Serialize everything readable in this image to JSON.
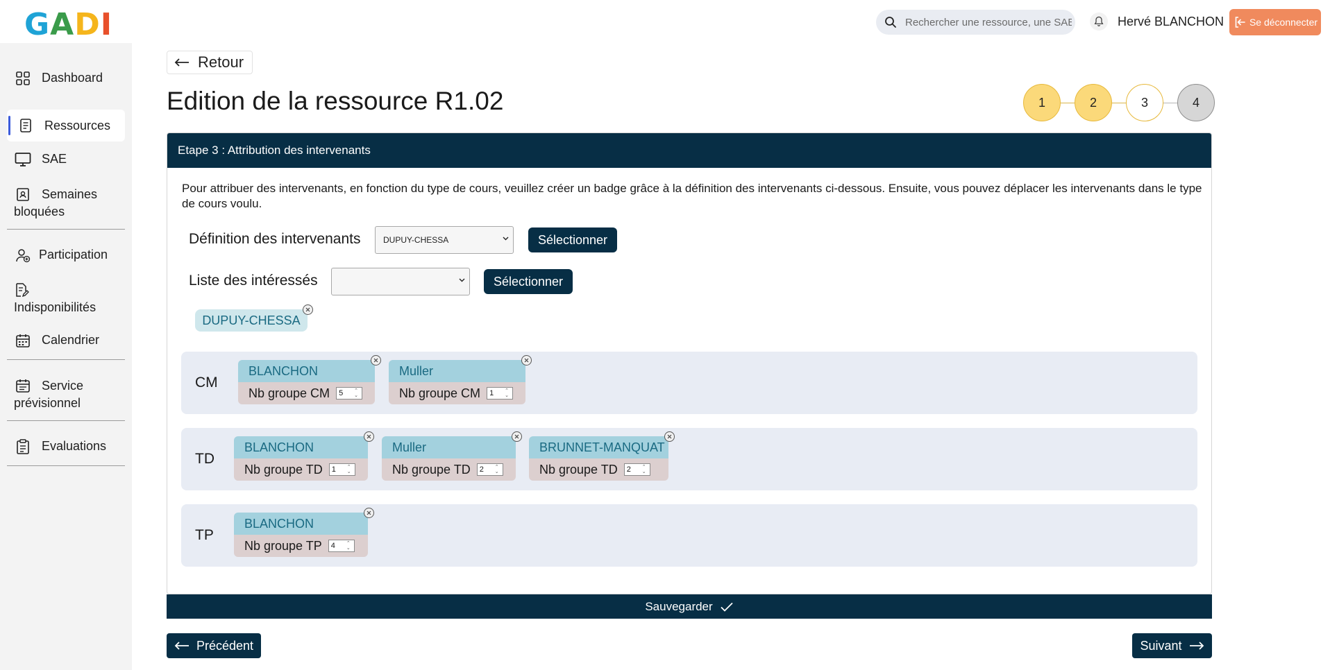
{
  "app": {
    "logo": [
      {
        "letter": "G",
        "color": "#1fa3d6"
      },
      {
        "letter": "A",
        "color": "#3a9b4a"
      },
      {
        "letter": "D",
        "color": "#f5b51c"
      },
      {
        "letter": "I",
        "color": "#e8502b"
      }
    ]
  },
  "header": {
    "search_placeholder": "Rechercher une ressource, une SAE ...",
    "username": "Hervé BLANCHON",
    "logout_label": "Se déconnecter"
  },
  "sidebar": {
    "items": [
      {
        "label": "Dashboard",
        "icon": "grid-icon"
      },
      {
        "label": "Ressources",
        "icon": "document-icon",
        "active": true
      },
      {
        "label": "SAE",
        "icon": "monitor-icon"
      },
      {
        "label": "Semaines bloquées",
        "icon": "calendar-lock-icon"
      },
      {
        "label": "Participation",
        "icon": "user-add-icon"
      },
      {
        "label": "Indisponibilités",
        "icon": "file-edit-icon"
      },
      {
        "label": "Calendrier",
        "icon": "calendar-icon"
      },
      {
        "label": "Service prévisionnel",
        "icon": "calendar-list-icon"
      },
      {
        "label": "Evaluations",
        "icon": "clipboard-icon"
      }
    ]
  },
  "main": {
    "back_label": "Retour",
    "title": "Edition de la ressource R1.02",
    "steps": [
      {
        "label": "1",
        "state": "done"
      },
      {
        "label": "2",
        "state": "done"
      },
      {
        "label": "3",
        "state": "current"
      },
      {
        "label": "4",
        "state": "pending"
      }
    ],
    "card_header": "Etape 3 : Attribution des intervenants",
    "intro": "Pour attribuer des intervenants, en fonction du type de cours, veuillez créer un badge grâce à la définition des intervenants ci-dessous. Ensuite, vous pouvez déplacer les intervenants dans le type de cours voulu.",
    "definition": {
      "label": "Définition des intervenants",
      "value": "DUPUY-CHESSA",
      "button": "Sélectionner"
    },
    "interested": {
      "label": "Liste des intéressés",
      "value": "",
      "button": "Sélectionner"
    },
    "pool_chip": "DUPUY-CHESSA",
    "groups": [
      {
        "type": "CM",
        "badges": [
          {
            "name": "BLANCHON",
            "label": "Nb groupe CM",
            "count": "5"
          },
          {
            "name": "Muller",
            "label": "Nb groupe CM",
            "count": "1"
          }
        ]
      },
      {
        "type": "TD",
        "badges": [
          {
            "name": "BLANCHON",
            "label": "Nb groupe TD",
            "count": "1"
          },
          {
            "name": "Muller",
            "label": "Nb groupe TD",
            "count": "2"
          },
          {
            "name": "BRUNNET-MANQUAT",
            "label": "Nb groupe TD",
            "count": "2"
          }
        ]
      },
      {
        "type": "TP",
        "badges": [
          {
            "name": "BLANCHON",
            "label": "Nb groupe TP",
            "count": "4"
          }
        ]
      }
    ],
    "save_label": "Sauvegarder",
    "prev_label": "Précédent",
    "next_label": "Suivant"
  },
  "colors": {
    "primary_dark": "#072e45",
    "step_done": "#fbd97a",
    "logout": "#f08a5d"
  }
}
